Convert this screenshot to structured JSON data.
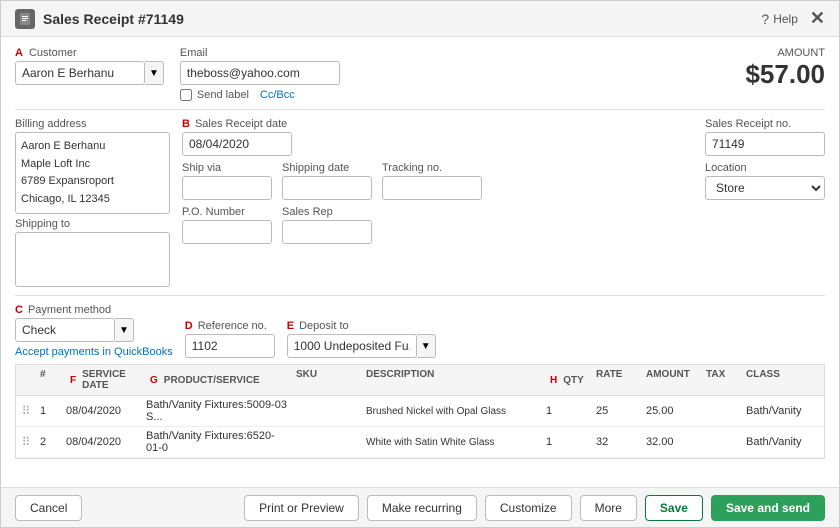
{
  "header": {
    "icon": "📄",
    "title": "Sales Receipt #71149",
    "help_label": "Help",
    "close_label": "✕"
  },
  "amount": {
    "label": "AMOUNT",
    "value": "$57.00"
  },
  "customer": {
    "label": "Customer",
    "section_label": "A",
    "value": "Aaron E Berhanu",
    "dropdown_arrow": "▼"
  },
  "email": {
    "label": "Email",
    "value": "theboss@yahoo.com"
  },
  "send_label": {
    "checkbox_label": "Send label",
    "cc_bcc": "Cc/Bcc"
  },
  "billing": {
    "label": "Billing address",
    "line1": "Aaron E Berhanu",
    "line2": "Maple Loft Inc",
    "line3": "6789 Expansroport",
    "line4": "Chicago, IL 12345"
  },
  "shipping": {
    "label": "Shipping to"
  },
  "receipt_date": {
    "label": "Sales Receipt date",
    "section_label": "B",
    "value": "08/04/2020"
  },
  "receipt_no": {
    "label": "Sales Receipt no.",
    "value": "71149"
  },
  "ship_via": {
    "label": "Ship via",
    "value": ""
  },
  "shipping_date": {
    "label": "Shipping date",
    "value": ""
  },
  "tracking_no": {
    "label": "Tracking no.",
    "value": ""
  },
  "location": {
    "label": "Location",
    "value": "Store"
  },
  "po_number": {
    "label": "P.O. Number",
    "value": ""
  },
  "sales_rep": {
    "label": "Sales Rep",
    "value": ""
  },
  "payment": {
    "label": "Payment method",
    "section_label": "C",
    "value": "Check"
  },
  "reference": {
    "label": "Reference no.",
    "section_label": "D",
    "value": "1102"
  },
  "deposit": {
    "label": "Deposit to",
    "section_label": "E",
    "value": "1000 Undeposited Fu..."
  },
  "accept_link": "Accept payments in QuickBooks",
  "table": {
    "section_label_f": "F",
    "section_label_g": "G",
    "section_label_h": "H",
    "headers": [
      "",
      "#",
      "SERVICE DATE",
      "PRODUCT/SERVICE",
      "SKU",
      "DESCRIPTION",
      "QTY",
      "RATE",
      "AMOUNT",
      "TAX",
      "CLASS"
    ],
    "rows": [
      {
        "drag": "⠿",
        "num": "1",
        "date": "08/04/2020",
        "product": "Bath/Vanity Fixtures:5009-03 S...",
        "sku": "",
        "description": "Brushed Nickel with Opal Glass",
        "qty": "1",
        "rate": "25",
        "amount": "25.00",
        "tax": "",
        "class": "Bath/Vanity"
      },
      {
        "drag": "⠿",
        "num": "2",
        "date": "08/04/2020",
        "product": "Bath/Vanity Fixtures:6520-01-0",
        "sku": "",
        "description": "White with Satin White Glass",
        "qty": "1",
        "rate": "32",
        "amount": "32.00",
        "tax": "",
        "class": "Bath/Vanity"
      }
    ]
  },
  "footer": {
    "cancel_label": "Cancel",
    "print_label": "Print or Preview",
    "recurring_label": "Make recurring",
    "customize_label": "Customize",
    "more_label": "More",
    "save_label": "Save",
    "save_send_label": "Save and send"
  }
}
